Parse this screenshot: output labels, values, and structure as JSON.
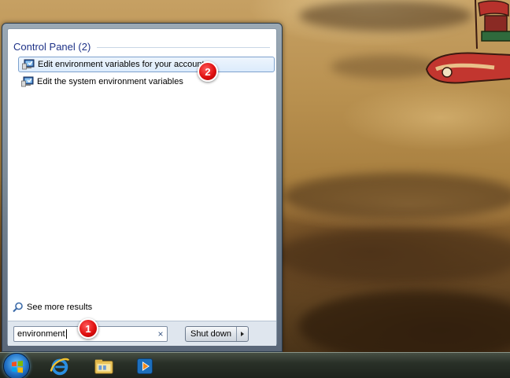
{
  "start_menu": {
    "group_header": "Control Panel (2)",
    "results": [
      {
        "label": "Edit environment variables for your account",
        "icon": "control-panel-system-icon",
        "highlighted": true
      },
      {
        "label": "Edit the system environment variables",
        "icon": "control-panel-system-icon",
        "highlighted": false
      }
    ],
    "see_more": "See more results",
    "search": {
      "value": "environment",
      "clear_icon": "×"
    },
    "shutdown": {
      "label": "Shut down"
    }
  },
  "callouts": {
    "first": "1",
    "second": "2"
  },
  "taskbar": {
    "items": [
      "start-orb-icon",
      "internet-explorer-icon",
      "windows-explorer-icon",
      "media-player-icon"
    ]
  },
  "colors": {
    "group_header": "#1e3287",
    "highlight_border": "#7da2ce",
    "badge": "#e01010"
  }
}
